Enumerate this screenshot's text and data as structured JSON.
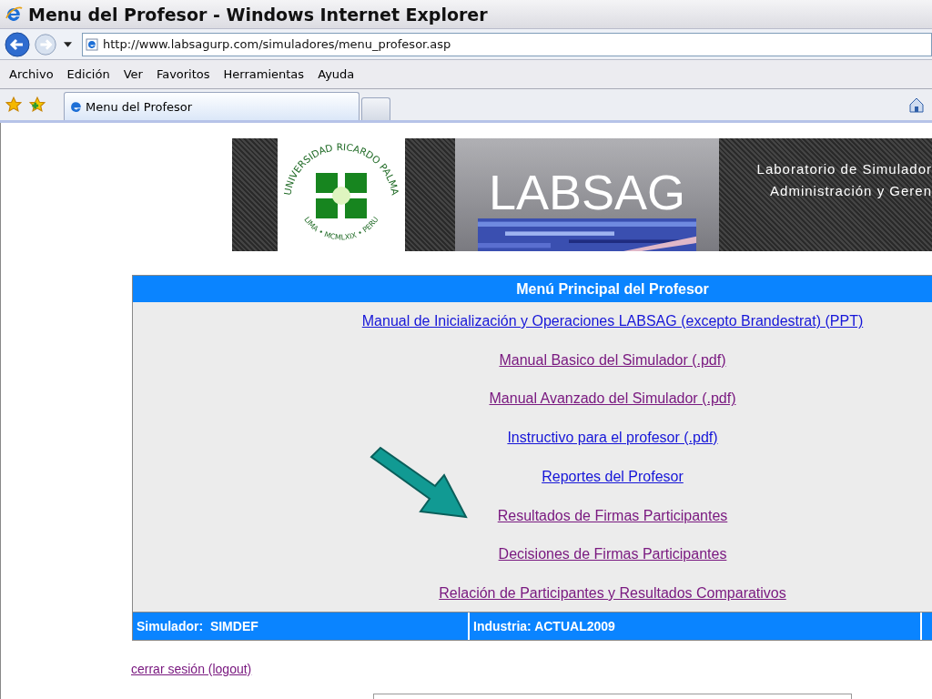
{
  "window": {
    "title": "Menu del Profesor - Windows Internet Explorer"
  },
  "address_bar": {
    "value": "http://www.labsagurp.com/simuladores/menu_profesor.asp"
  },
  "menu_bar": [
    "Archivo",
    "Edición",
    "Ver",
    "Favoritos",
    "Herramientas",
    "Ayuda"
  ],
  "tabs": [
    {
      "label": "Menu del Profesor",
      "selected": true
    }
  ],
  "banner": {
    "logo_top": "UNIVERSIDAD RICARDO PALMA",
    "logo_bottom": "LIMA • MCMLXIX • PERU",
    "title": "LABSAG",
    "subtitle_lines": [
      "Laboratorio de Simulador",
      "Administración y Geren"
    ]
  },
  "menu": {
    "title": "Menú Principal del Profesor",
    "links": [
      {
        "label": "Manual de Inicialización y Operaciones LABSAG (excepto Brandestrat) (PPT)",
        "visited": false
      },
      {
        "label": "Manual Basico del Simulador (.pdf)",
        "visited": true
      },
      {
        "label": "Manual Avanzado del Simulador (.pdf)",
        "visited": true
      },
      {
        "label": "Instructivo para el profesor (.pdf)",
        "visited": false
      },
      {
        "label": "Reportes del Profesor",
        "visited": false
      },
      {
        "label": "Resultados de Firmas Participantes",
        "visited": true
      },
      {
        "label": "Decisiones de Firmas Participantes",
        "visited": true
      },
      {
        "label": "Relación de Participantes y Resultados Comparativos",
        "visited": true
      }
    ],
    "footer": [
      "Simulador:  SIMDEF",
      "Industria: ACTUAL2009"
    ]
  },
  "logout": {
    "label": "cerrar sesión (logout)",
    "visited": true
  }
}
